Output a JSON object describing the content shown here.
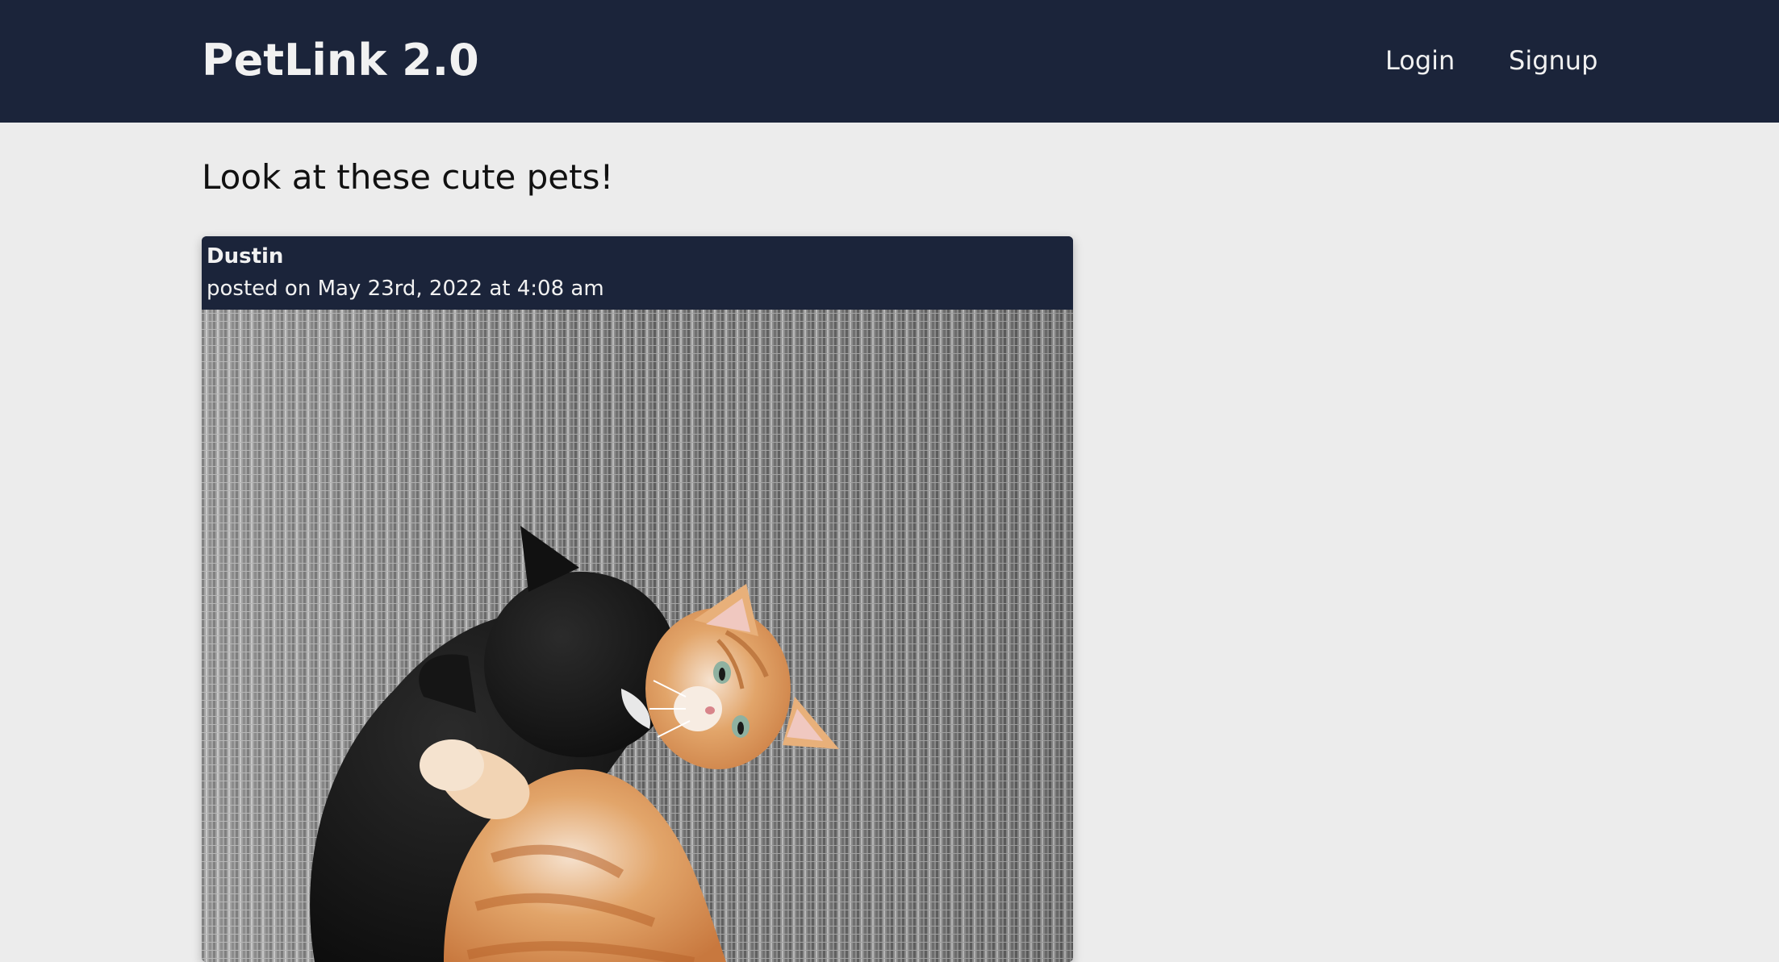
{
  "header": {
    "brand": "PetLink 2.0",
    "nav": {
      "login_label": "Login",
      "signup_label": "Signup"
    }
  },
  "main": {
    "heading": "Look at these cute pets!",
    "posts": [
      {
        "author": "Dustin",
        "posted_on": "posted on May 23rd, 2022 at 4:08 am",
        "image_icon": "cats-photo"
      }
    ]
  },
  "colors": {
    "nav_background": "#1b243a",
    "page_background": "#ececec",
    "text_light": "#f1f1f1",
    "text_dark": "#111111"
  }
}
